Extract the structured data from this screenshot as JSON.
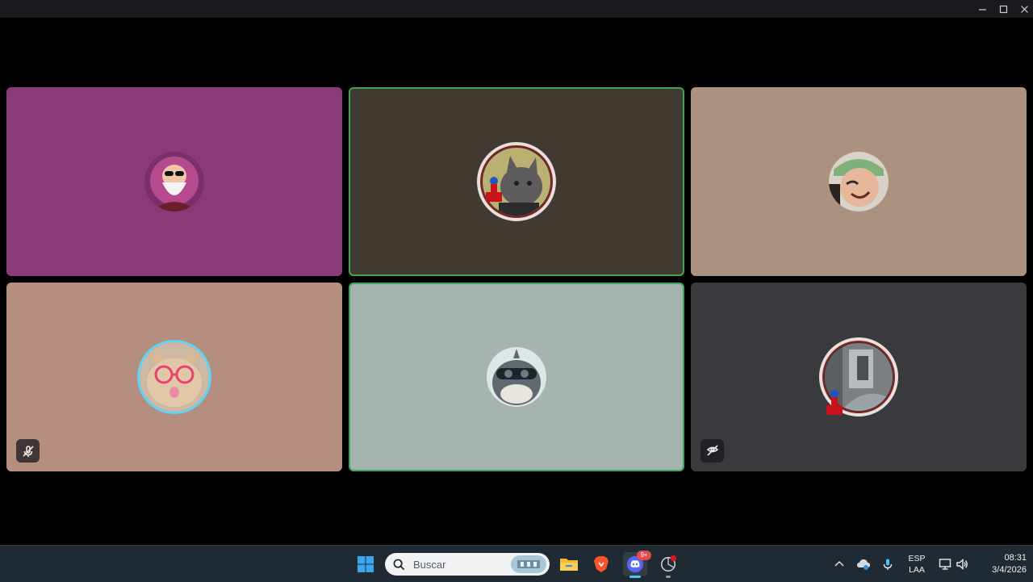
{
  "window": {
    "controls": [
      "minimize-icon",
      "maximize-icon",
      "close-icon"
    ]
  },
  "call": {
    "participants": [
      {
        "tile_color": "#8b3a78",
        "speaking": false,
        "avatar": "old-man-sunglasses-avatar",
        "status_icon": null
      },
      {
        "tile_color": "#403a30",
        "speaking": true,
        "avatar": "gray-cat-avatar-with-decoration",
        "status_icon": null
      },
      {
        "tile_color": "#aa9180",
        "speaking": false,
        "avatar": "smiling-person-avatar",
        "status_icon": null
      },
      {
        "tile_color": "#b58e80",
        "speaking": false,
        "avatar": "cat-with-glasses-avatar",
        "status_icon": "muted-mic-icon"
      },
      {
        "tile_color": "#a5b4ae",
        "speaking": true,
        "avatar": "shark-with-goggles-avatar",
        "status_icon": null
      },
      {
        "tile_color": "#3a3a3e",
        "speaking": false,
        "avatar": "room-photo-avatar-with-decoration",
        "status_icon": "camera-off-icon"
      }
    ],
    "speaking_border_color": "#43a25a"
  },
  "taskbar": {
    "search": {
      "placeholder": "Buscar"
    },
    "apps": [
      "windows-start-icon",
      "file-explorer-icon",
      "brave-browser-icon",
      "discord-icon",
      "browser-recording-icon"
    ],
    "discord_badge": "9+",
    "tray": {
      "language_line1": "ESP",
      "language_line2": "LAA",
      "time": "08:31",
      "date": "3/4/2026"
    }
  }
}
